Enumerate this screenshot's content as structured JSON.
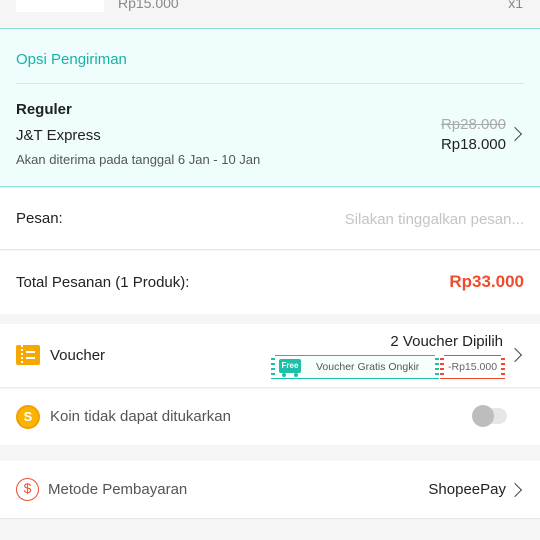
{
  "product": {
    "price": "Rp15.000",
    "quantity": "x1"
  },
  "shipping": {
    "title": "Opsi Pengiriman",
    "type": "Reguler",
    "courier": "J&T Express",
    "eta": "Akan diterima pada tanggal 6 Jan - 10 Jan",
    "original_price": "Rp28.000",
    "price": "Rp18.000"
  },
  "message": {
    "label": "Pesan:",
    "placeholder": "Silakan tinggalkan pesan..."
  },
  "total": {
    "label": "Total Pesanan (1 Produk):",
    "value": "Rp33.000"
  },
  "voucher": {
    "label": "Voucher",
    "selected": "2 Voucher Dipilih",
    "free_badge": "Free",
    "shipping_voucher": "Voucher Gratis Ongkir",
    "discount": "-Rp15.000"
  },
  "coins": {
    "label": "Koin tidak dapat ditukarkan",
    "coin_symbol": "S",
    "enabled": false
  },
  "payment": {
    "label": "Metode Pembayaran",
    "icon_symbol": "$",
    "value": "ShopeePay"
  },
  "colors": {
    "accent": "#ee4d2d",
    "teal": "#17b3a6",
    "voucher_yellow": "#f6a700",
    "coin_gold": "#f8b400"
  }
}
